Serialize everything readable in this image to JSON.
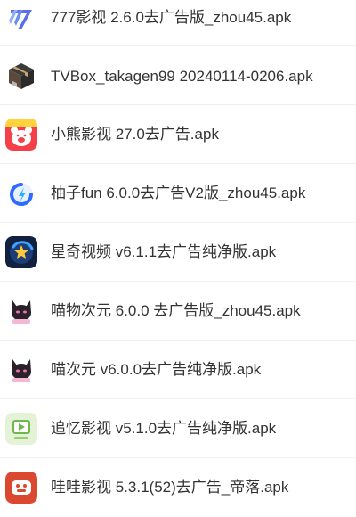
{
  "files": [
    {
      "name": "777影视 2.6.0去广告版_zhou45.apk",
      "icon": "777-app-icon"
    },
    {
      "name": "TVBox_takagen99 20240114-0206.apk",
      "icon": "box-app-icon"
    },
    {
      "name": "小熊影视 27.0去广告.apk",
      "icon": "bear-app-icon"
    },
    {
      "name": "柚子fun 6.0.0去广告V2版_zhou45.apk",
      "icon": "grapefruit-app-icon"
    },
    {
      "name": "星奇视频 v6.1.1去广告纯净版.apk",
      "icon": "star-app-icon"
    },
    {
      "name": "喵物次元 6.0.0 去广告版_zhou45.apk",
      "icon": "cat-app-icon"
    },
    {
      "name": "喵次元 v6.0.0去广告纯净版.apk",
      "icon": "cat-app-icon"
    },
    {
      "name": "追忆影视 v5.1.0去广告纯净版.apk",
      "icon": "tv-app-icon"
    },
    {
      "name": "哇哇影视 5.3.1(52)去广告_帝落.apk",
      "icon": "wawa-app-icon"
    }
  ]
}
